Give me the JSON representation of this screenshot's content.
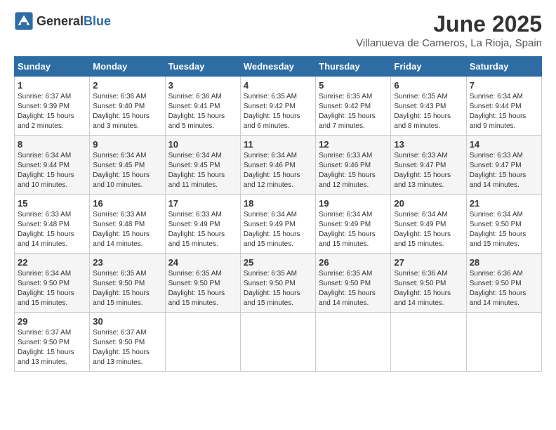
{
  "logo": {
    "general": "General",
    "blue": "Blue"
  },
  "title": "June 2025",
  "subtitle": "Villanueva de Cameros, La Rioja, Spain",
  "days_of_week": [
    "Sunday",
    "Monday",
    "Tuesday",
    "Wednesday",
    "Thursday",
    "Friday",
    "Saturday"
  ],
  "weeks": [
    [
      {
        "day": "1",
        "sunrise": "6:37 AM",
        "sunset": "9:39 PM",
        "daylight": "15 hours and 2 minutes."
      },
      {
        "day": "2",
        "sunrise": "6:36 AM",
        "sunset": "9:40 PM",
        "daylight": "15 hours and 3 minutes."
      },
      {
        "day": "3",
        "sunrise": "6:36 AM",
        "sunset": "9:41 PM",
        "daylight": "15 hours and 5 minutes."
      },
      {
        "day": "4",
        "sunrise": "6:35 AM",
        "sunset": "9:42 PM",
        "daylight": "15 hours and 6 minutes."
      },
      {
        "day": "5",
        "sunrise": "6:35 AM",
        "sunset": "9:42 PM",
        "daylight": "15 hours and 7 minutes."
      },
      {
        "day": "6",
        "sunrise": "6:35 AM",
        "sunset": "9:43 PM",
        "daylight": "15 hours and 8 minutes."
      },
      {
        "day": "7",
        "sunrise": "6:34 AM",
        "sunset": "9:44 PM",
        "daylight": "15 hours and 9 minutes."
      }
    ],
    [
      {
        "day": "8",
        "sunrise": "6:34 AM",
        "sunset": "9:44 PM",
        "daylight": "15 hours and 10 minutes."
      },
      {
        "day": "9",
        "sunrise": "6:34 AM",
        "sunset": "9:45 PM",
        "daylight": "15 hours and 10 minutes."
      },
      {
        "day": "10",
        "sunrise": "6:34 AM",
        "sunset": "9:45 PM",
        "daylight": "15 hours and 11 minutes."
      },
      {
        "day": "11",
        "sunrise": "6:34 AM",
        "sunset": "9:46 PM",
        "daylight": "15 hours and 12 minutes."
      },
      {
        "day": "12",
        "sunrise": "6:33 AM",
        "sunset": "9:46 PM",
        "daylight": "15 hours and 12 minutes."
      },
      {
        "day": "13",
        "sunrise": "6:33 AM",
        "sunset": "9:47 PM",
        "daylight": "15 hours and 13 minutes."
      },
      {
        "day": "14",
        "sunrise": "6:33 AM",
        "sunset": "9:47 PM",
        "daylight": "15 hours and 14 minutes."
      }
    ],
    [
      {
        "day": "15",
        "sunrise": "6:33 AM",
        "sunset": "9:48 PM",
        "daylight": "15 hours and 14 minutes."
      },
      {
        "day": "16",
        "sunrise": "6:33 AM",
        "sunset": "9:48 PM",
        "daylight": "15 hours and 14 minutes."
      },
      {
        "day": "17",
        "sunrise": "6:33 AM",
        "sunset": "9:49 PM",
        "daylight": "15 hours and 15 minutes."
      },
      {
        "day": "18",
        "sunrise": "6:34 AM",
        "sunset": "9:49 PM",
        "daylight": "15 hours and 15 minutes."
      },
      {
        "day": "19",
        "sunrise": "6:34 AM",
        "sunset": "9:49 PM",
        "daylight": "15 hours and 15 minutes."
      },
      {
        "day": "20",
        "sunrise": "6:34 AM",
        "sunset": "9:49 PM",
        "daylight": "15 hours and 15 minutes."
      },
      {
        "day": "21",
        "sunrise": "6:34 AM",
        "sunset": "9:50 PM",
        "daylight": "15 hours and 15 minutes."
      }
    ],
    [
      {
        "day": "22",
        "sunrise": "6:34 AM",
        "sunset": "9:50 PM",
        "daylight": "15 hours and 15 minutes."
      },
      {
        "day": "23",
        "sunrise": "6:35 AM",
        "sunset": "9:50 PM",
        "daylight": "15 hours and 15 minutes."
      },
      {
        "day": "24",
        "sunrise": "6:35 AM",
        "sunset": "9:50 PM",
        "daylight": "15 hours and 15 minutes."
      },
      {
        "day": "25",
        "sunrise": "6:35 AM",
        "sunset": "9:50 PM",
        "daylight": "15 hours and 15 minutes."
      },
      {
        "day": "26",
        "sunrise": "6:35 AM",
        "sunset": "9:50 PM",
        "daylight": "15 hours and 14 minutes."
      },
      {
        "day": "27",
        "sunrise": "6:36 AM",
        "sunset": "9:50 PM",
        "daylight": "15 hours and 14 minutes."
      },
      {
        "day": "28",
        "sunrise": "6:36 AM",
        "sunset": "9:50 PM",
        "daylight": "15 hours and 14 minutes."
      }
    ],
    [
      {
        "day": "29",
        "sunrise": "6:37 AM",
        "sunset": "9:50 PM",
        "daylight": "15 hours and 13 minutes."
      },
      {
        "day": "30",
        "sunrise": "6:37 AM",
        "sunset": "9:50 PM",
        "daylight": "15 hours and 13 minutes."
      },
      null,
      null,
      null,
      null,
      null
    ]
  ],
  "labels": {
    "sunrise": "Sunrise:",
    "sunset": "Sunset:",
    "daylight": "Daylight:"
  }
}
